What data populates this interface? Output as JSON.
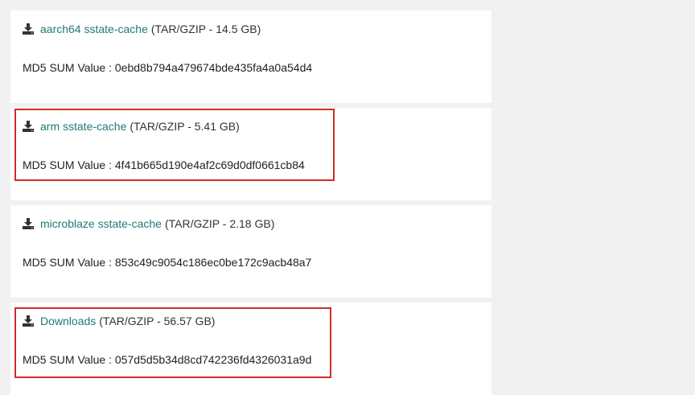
{
  "items": [
    {
      "name": "aarch64 sstate-cache",
      "meta": "(TAR/GZIP - 14.5 GB)",
      "md5_label": "MD5 SUM Value :",
      "md5": "0ebd8b794a479674bde435fa4a0a54d4",
      "icon": "download-icon",
      "highlighted": false
    },
    {
      "name": "arm sstate-cache",
      "meta": "(TAR/GZIP - 5.41 GB)",
      "md5_label": "MD5 SUM Value :",
      "md5": "4f41b665d190e4af2c69d0df0661cb84",
      "icon": "download-icon",
      "highlighted": true
    },
    {
      "name": "microblaze sstate-cache",
      "meta": "(TAR/GZIP - 2.18 GB)",
      "md5_label": "MD5 SUM Value :",
      "md5": "853c49c9054c186ec0be172c9acb48a7",
      "icon": "download-icon",
      "highlighted": false
    },
    {
      "name": "Downloads",
      "meta": "(TAR/GZIP - 56.57 GB)",
      "md5_label": "MD5 SUM Value :",
      "md5": "057d5d5b34d8cd742236fd4326031a9d",
      "icon": "download-icon",
      "highlighted": true
    }
  ],
  "colors": {
    "link": "#1e7b75",
    "highlight": "#d42a2a",
    "card": "#ffffff",
    "background": "#f1f1f1"
  }
}
